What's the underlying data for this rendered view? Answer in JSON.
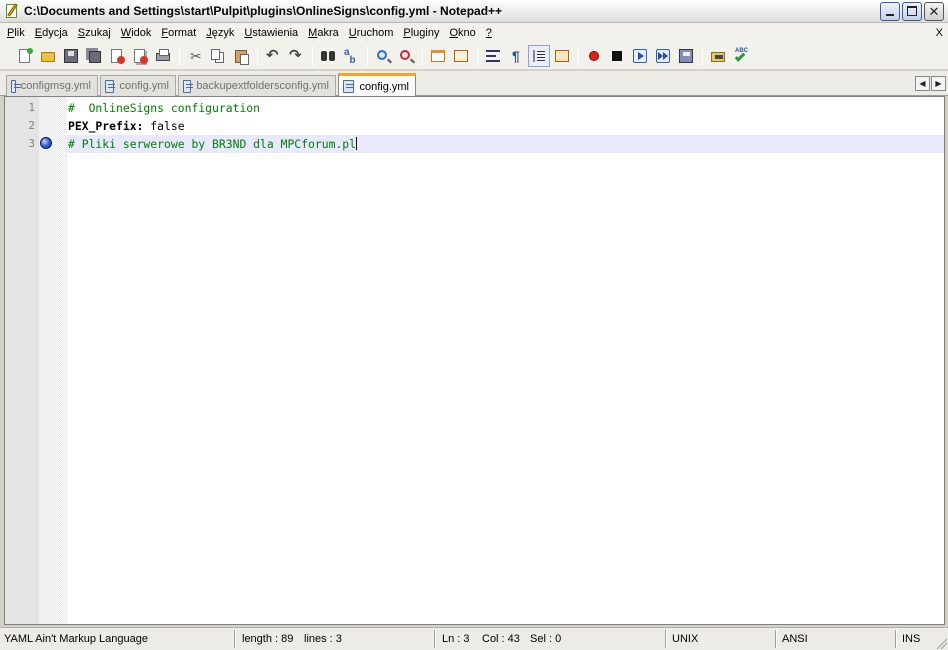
{
  "window": {
    "title": "C:\\Documents and Settings\\start\\Pulpit\\plugins\\OnlineSigns\\config.yml - Notepad++"
  },
  "menu": {
    "items": [
      {
        "ul": "P",
        "rest": "lik"
      },
      {
        "ul": "E",
        "rest": "dycja"
      },
      {
        "ul": "S",
        "rest": "zukaj"
      },
      {
        "ul": "W",
        "rest": "idok"
      },
      {
        "ul": "F",
        "rest": "ormat"
      },
      {
        "ul": "J",
        "rest": "ęzyk"
      },
      {
        "ul": "U",
        "rest": "stawienia"
      },
      {
        "ul": "M",
        "rest": "akra"
      },
      {
        "ul": "U",
        "rest": "ruchom"
      },
      {
        "ul": "P",
        "rest": "luginy"
      },
      {
        "ul": "O",
        "rest": "kno"
      },
      {
        "ul": "?",
        "rest": ""
      }
    ],
    "close_doc": "X"
  },
  "toolbar": {
    "icons": [
      "new-file-icon",
      "open-folder-icon",
      "save-icon",
      "save-all-icon",
      "close-icon",
      "close-all-icon",
      "print-icon",
      "cut-icon",
      "copy-icon",
      "paste-icon",
      "undo-icon",
      "redo-icon",
      "find-icon",
      "replace-icon",
      "zoom-in-icon",
      "zoom-out-icon",
      "sync-vertical-icon",
      "sync-horizontal-icon",
      "word-wrap-icon",
      "show-all-chars-icon",
      "indent-guide-icon",
      "user-language-icon",
      "record-macro-icon",
      "stop-recording-icon",
      "play-macro-icon",
      "run-macro-multiple-icon",
      "save-macro-icon",
      "open-file-icon",
      "spell-check-icon"
    ]
  },
  "tabs": [
    {
      "label": "configmsg.yml",
      "active": false
    },
    {
      "label": "config.yml",
      "active": false
    },
    {
      "label": "backupextfoldersconfig.yml",
      "active": false
    },
    {
      "label": "config.yml",
      "active": true
    }
  ],
  "editor": {
    "lines": [
      {
        "number": "1",
        "text": "#  OnlineSigns configuration"
      },
      {
        "number": "2",
        "key": "PEX_Prefix:",
        "value": " false"
      },
      {
        "number": "3",
        "text": "# Pliki serwerowe by BR3ND dla MPCforum.pl"
      }
    ],
    "current_line": 3,
    "bookmark_line": 3,
    "colors": {
      "comment": "#008000",
      "current_line_bg": "#e8e8ff",
      "active_tab_accent": "#f4a626"
    }
  },
  "status": {
    "language": "YAML Ain't Markup Language",
    "length": "length : 89",
    "lines": "lines : 3",
    "ln": "Ln : 3",
    "col": "Col : 43",
    "sel": "Sel : 0",
    "eol": "UNIX",
    "encoding": "ANSI",
    "mode": "INS"
  }
}
